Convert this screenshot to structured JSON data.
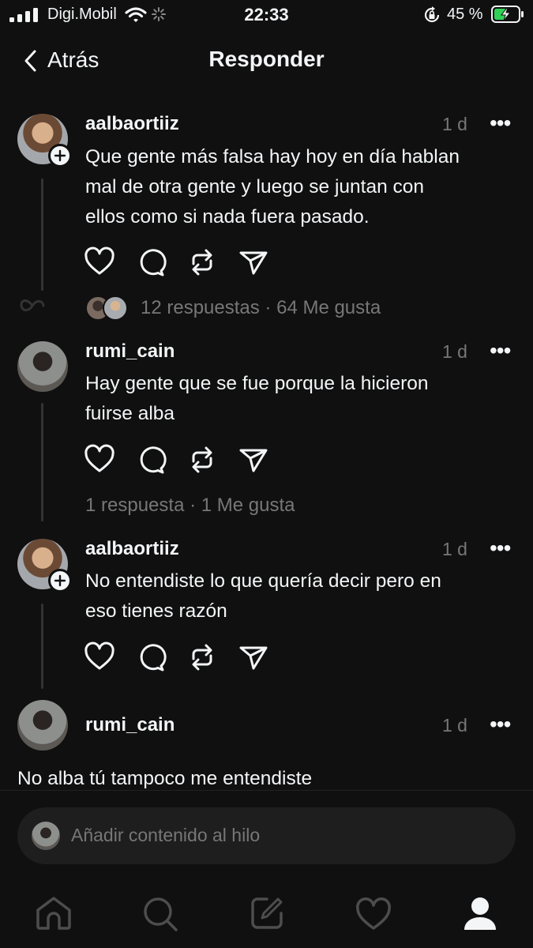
{
  "status_bar": {
    "carrier": "Digi.Mobil",
    "time": "22:33",
    "battery": "45 %"
  },
  "header": {
    "back_label": "Atrás",
    "title": "Responder"
  },
  "posts": [
    {
      "username": "aalbaortiiz",
      "time": "1 d",
      "text_lines": [
        "Que gente más falsa hay hoy en día hablan",
        "mal de otra gente y luego se juntan con",
        "ellos como si nada fuera pasado."
      ],
      "meta": "12 respuestas · 64 Me gusta"
    },
    {
      "username": "rumi_cain",
      "time": "1 d",
      "text_lines": [
        "Hay gente que se fue porque la hicieron",
        "fuirse alba"
      ],
      "meta": "1 respuesta · 1 Me gusta"
    },
    {
      "username": "aalbaortiiz",
      "time": "1 d",
      "text_lines": [
        "No entendiste lo que quería decir pero en",
        "eso tienes razón"
      ]
    },
    {
      "username": "rumi_cain",
      "time": "1 d",
      "text_lines": [
        "No alba tú tampoco me entendiste"
      ]
    }
  ],
  "more_symbol": "•••",
  "composer": {
    "placeholder": "Añadir contenido al hilo"
  },
  "icons": {
    "signal": "signal-icon",
    "wifi": "wifi-icon",
    "loading": "loading-icon",
    "lock_rotation": "orientation-lock-icon",
    "battery": "battery-charging-icon",
    "back": "chevron-left-icon",
    "like": "heart-icon",
    "comment": "comment-icon",
    "repost": "repost-icon",
    "share": "send-icon",
    "more": "more-icon",
    "nav_home": "home-icon",
    "nav_search": "search-icon",
    "nav_compose": "compose-icon",
    "nav_activity": "heart-icon",
    "nav_profile": "profile-icon"
  },
  "colors": {
    "background": "#101010",
    "text": "#f3f5f7",
    "secondary": "#777777",
    "battery_charge": "#30d158"
  }
}
